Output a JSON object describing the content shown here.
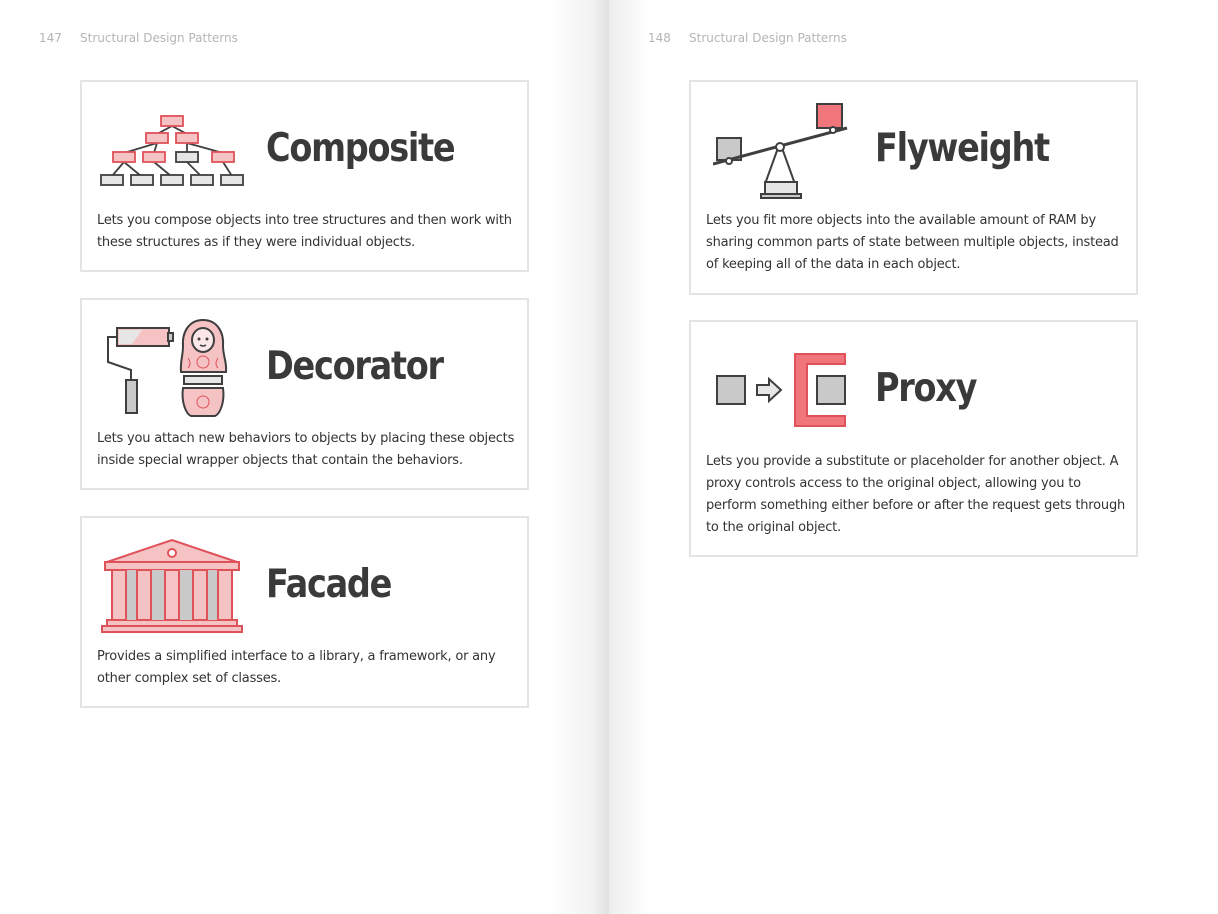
{
  "left_page": {
    "page_number": "147",
    "running_head": "Structural Design Patterns",
    "cards": [
      {
        "title": "Composite",
        "description": "Lets you compose objects into tree structures and then work with these structures as if they were individual objects.",
        "icon": "tree-hierarchy-icon"
      },
      {
        "title": "Decorator",
        "description": "Lets you attach new behaviors to objects by placing these objects inside special wrapper objects that contain the behaviors.",
        "icon": "paint-roller-matryoshka-icon"
      },
      {
        "title": "Facade",
        "description": "Provides a simplified interface to a library, a framework, or any other complex set of classes.",
        "icon": "temple-facade-icon"
      }
    ]
  },
  "right_page": {
    "page_number": "148",
    "running_head": "Structural Design Patterns",
    "cards": [
      {
        "title": "Flyweight",
        "description": "Lets you fit more objects into the available amount of RAM by sharing common parts of state between multiple objects, instead of keeping all of the data in each object.",
        "icon": "seesaw-icon"
      },
      {
        "title": "Proxy",
        "description": "Lets you provide a substitute or placeholder for another object. A proxy controls access to the original object, allowing you to perform something either before or after the request gets through to the original object.",
        "icon": "proxy-bracket-icon"
      }
    ]
  },
  "colors": {
    "accent_red": "#e0525a",
    "accent_pink": "#f6c3c5",
    "icon_gray": "#c9c9c9",
    "outline": "#3f3f3f",
    "card_border": "#e4e4e4"
  }
}
